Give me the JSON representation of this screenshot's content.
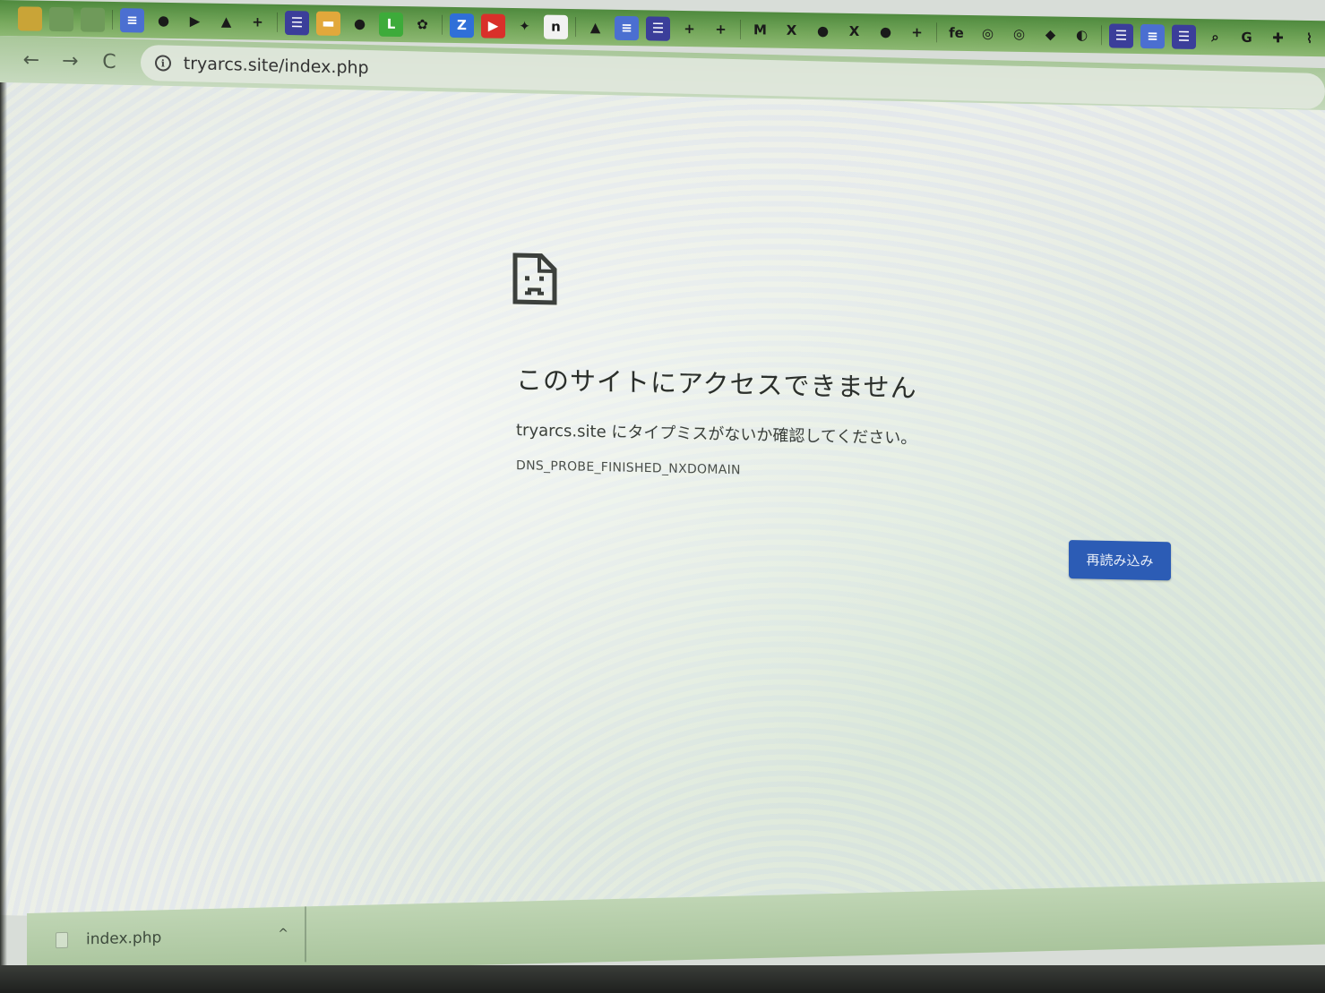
{
  "browser": {
    "url": "tryarcs.site/index.php",
    "nav": {
      "back_icon": "back-arrow-icon",
      "forward_icon": "forward-arrow-icon",
      "reload_icon": "reload-icon",
      "back_glyph": "←",
      "forward_glyph": "→",
      "reload_glyph": "C"
    },
    "bookmarks": [
      {
        "name": "app-icon",
        "glyph": "",
        "bg": "#c9a437"
      },
      {
        "name": "extension-icon",
        "glyph": "",
        "bg": "#6f9a5a"
      },
      {
        "name": "extension-icon",
        "glyph": "",
        "bg": "#6f9a5a"
      },
      {
        "name": "docs-icon",
        "glyph": "≡",
        "bg": "#4b6fd1"
      },
      {
        "name": "globe-icon",
        "glyph": "●",
        "bg": "transparent"
      },
      {
        "name": "play-icon",
        "glyph": "▶",
        "bg": "transparent"
      },
      {
        "name": "drive-icon",
        "glyph": "▲",
        "bg": "transparent"
      },
      {
        "name": "plus-icon",
        "glyph": "+",
        "bg": "transparent"
      },
      {
        "name": "list-icon",
        "glyph": "☰",
        "bg": "#3b3e9a"
      },
      {
        "name": "slides-icon",
        "glyph": "▬",
        "bg": "#e2a83b"
      },
      {
        "name": "chat-icon",
        "glyph": "●",
        "bg": "transparent"
      },
      {
        "name": "line-icon",
        "glyph": "L",
        "bg": "#3dab3a"
      },
      {
        "name": "flower-icon",
        "glyph": "✿",
        "bg": "transparent"
      },
      {
        "name": "zoom-icon",
        "glyph": "Z",
        "bg": "#2f6fd8"
      },
      {
        "name": "youtube-icon",
        "glyph": "▶",
        "bg": "#d9302a"
      },
      {
        "name": "twitter-icon",
        "glyph": "✦",
        "bg": "transparent"
      },
      {
        "name": "notion-icon",
        "glyph": "n",
        "bg": "#f2f2f2"
      },
      {
        "name": "drive-icon",
        "glyph": "▲",
        "bg": "transparent"
      },
      {
        "name": "docs-icon",
        "glyph": "≡",
        "bg": "#4b6fd1"
      },
      {
        "name": "list-icon",
        "glyph": "☰",
        "bg": "#3b3e9a"
      },
      {
        "name": "plus-icon",
        "glyph": "+",
        "bg": "transparent"
      },
      {
        "name": "plus-icon",
        "glyph": "+",
        "bg": "transparent"
      },
      {
        "name": "gmail-icon",
        "glyph": "M",
        "bg": "transparent"
      },
      {
        "name": "x-icon",
        "glyph": "X",
        "bg": "transparent"
      },
      {
        "name": "globe-icon",
        "glyph": "●",
        "bg": "transparent"
      },
      {
        "name": "x-icon",
        "glyph": "X",
        "bg": "transparent"
      },
      {
        "name": "globe-icon",
        "glyph": "●",
        "bg": "transparent"
      },
      {
        "name": "plus-icon",
        "glyph": "+",
        "bg": "transparent"
      },
      {
        "name": "fe-icon",
        "glyph": "fe",
        "bg": "transparent"
      },
      {
        "name": "circle-icon",
        "glyph": "◎",
        "bg": "transparent"
      },
      {
        "name": "circle-icon",
        "glyph": "◎",
        "bg": "transparent"
      },
      {
        "name": "diamond-icon",
        "glyph": "◆",
        "bg": "transparent"
      },
      {
        "name": "flame-icon",
        "glyph": "◐",
        "bg": "transparent"
      },
      {
        "name": "list-icon",
        "glyph": "☰",
        "bg": "#3b3e9a"
      },
      {
        "name": "docs-icon",
        "glyph": "≡",
        "bg": "#4b6fd1"
      },
      {
        "name": "list-icon",
        "glyph": "☰",
        "bg": "#3b3e9a"
      },
      {
        "name": "search-icon",
        "glyph": "⌕",
        "bg": "transparent"
      },
      {
        "name": "google-icon",
        "glyph": "G",
        "bg": "transparent"
      },
      {
        "name": "puzzle-icon",
        "glyph": "✚",
        "bg": "transparent"
      },
      {
        "name": "feed-icon",
        "glyph": "⌇",
        "bg": "transparent"
      }
    ]
  },
  "error": {
    "title": "このサイトにアクセスできません",
    "detail": "tryarcs.site にタイプミスがないか確認してください。",
    "code": "DNS_PROBE_FINISHED_NXDOMAIN",
    "reload_label": "再読み込み",
    "icon": "sad-document-icon"
  },
  "downloads": {
    "items": [
      {
        "name": "index.php"
      }
    ],
    "chevron": "^"
  },
  "colors": {
    "reload_button": "#2c5cb5"
  }
}
